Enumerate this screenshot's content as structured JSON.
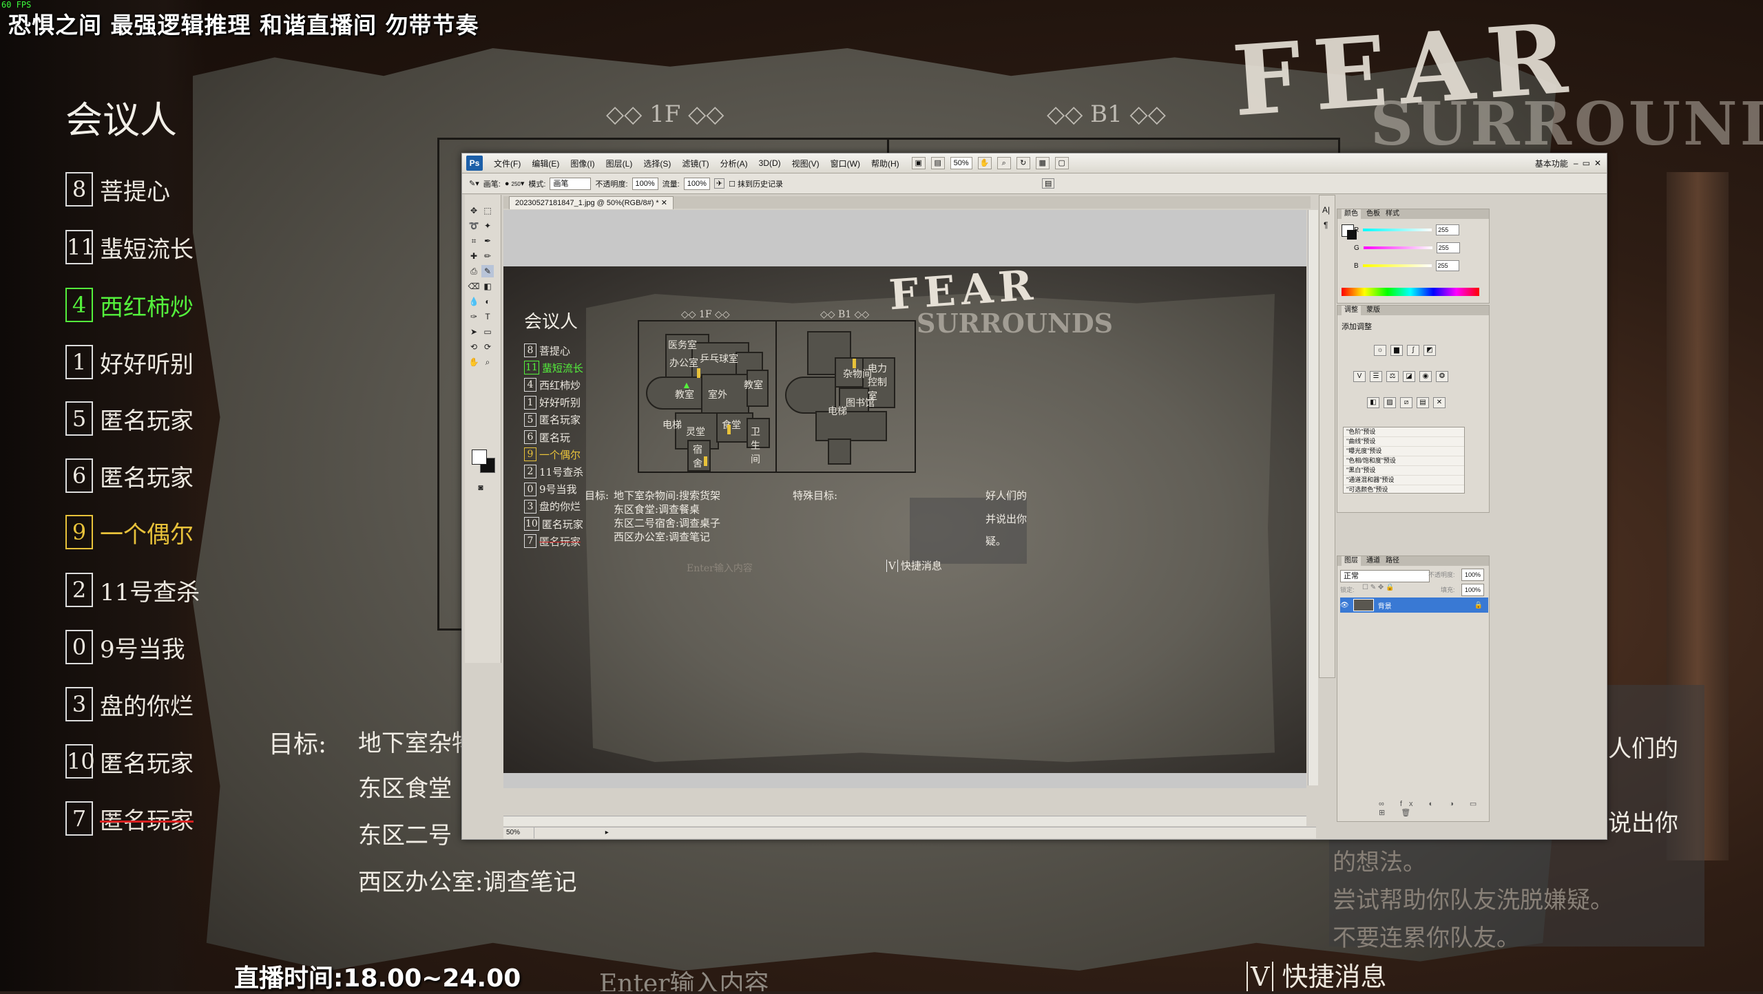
{
  "overlay": {
    "fps": "60 FPS",
    "stream_title": "恐惧之间 最强逻辑推理 和谐直播间 勿带节奏",
    "stream_time": "直播时间:18.00~24.00"
  },
  "game": {
    "logo": "FEAR",
    "logo_sub": "SURROUNDS",
    "members_title": "会议人",
    "members": [
      {
        "num": "8",
        "name": "菩提心",
        "state": "normal"
      },
      {
        "num": "11",
        "name": "蜚短流长",
        "state": "normal"
      },
      {
        "num": "4",
        "name": "西红柿炒",
        "state": "green"
      },
      {
        "num": "1",
        "name": "好好听别",
        "state": "normal"
      },
      {
        "num": "5",
        "name": "匿名玩家",
        "state": "normal"
      },
      {
        "num": "6",
        "name": "匿名玩家",
        "state": "normal"
      },
      {
        "num": "9",
        "name": "一个偶尔",
        "state": "yellow"
      },
      {
        "num": "2",
        "name": "11号查杀",
        "state": "normal"
      },
      {
        "num": "0",
        "name": "9号当我",
        "state": "normal"
      },
      {
        "num": "3",
        "name": "盘的你烂",
        "state": "normal"
      },
      {
        "num": "10",
        "name": "匿名玩家",
        "state": "normal"
      },
      {
        "num": "7",
        "name": "匿名玩家",
        "state": "red"
      }
    ],
    "floor_1f": "1F",
    "floor_b1": "B1",
    "goal_label": "目标:",
    "goal_lines": [
      "地下室杂物",
      "东区食堂",
      "东区二号",
      "西区办公室:调查笔记"
    ],
    "right_lines": [
      "人们的",
      "说出你",
      "的想法。",
      "尝试帮助你队友洗脱嫌疑。",
      "不要连累你队友。"
    ],
    "enter_hint": "Enter输入内容",
    "quick_key": "V",
    "quick_msg": "快捷消息"
  },
  "photoshop": {
    "ps_icon": "Ps",
    "menus": [
      "文件(F)",
      "编辑(E)",
      "图像(I)",
      "图层(L)",
      "选择(S)",
      "滤镜(T)",
      "分析(A)",
      "3D(D)",
      "视图(V)",
      "窗口(W)",
      "帮助(H)"
    ],
    "zoom_select": "50%",
    "workspace": "基本功能",
    "options": {
      "brush_label": "画笔:",
      "brush_size": "250",
      "mode_label": "模式:",
      "mode_value": "画笔",
      "opacity_label": "不透明度:",
      "opacity_value": "100%",
      "flow_label": "流量:",
      "flow_value": "100%",
      "erase_history": "抹到历史记录"
    },
    "doc_tab": "20230527181847_1.jpg @ 50%(RGB/8#) *",
    "status_zoom": "50%",
    "color_panel": {
      "tabs": [
        "颜色",
        "色板",
        "样式"
      ],
      "r_label": "R",
      "r_value": "255",
      "g_label": "G",
      "g_value": "255",
      "b_label": "B",
      "b_value": "255"
    },
    "adjust_panel": {
      "tabs": [
        "调整",
        "蒙版"
      ],
      "title": "添加调整",
      "presets": [
        "\"色阶\"预设",
        "\"曲线\"预设",
        "\"曝光度\"预设",
        "\"色相/饱和度\"预设",
        "\"黑白\"预设",
        "\"通道混和器\"预设",
        "\"可选颜色\"预设"
      ]
    },
    "layers_panel": {
      "tabs": [
        "图层",
        "通道",
        "路径"
      ],
      "blend_mode": "正常",
      "opacity_label": "不透明度:",
      "opacity_value": "100%",
      "lock_label": "锁定:",
      "fill_label": "填充:",
      "fill_value": "100%",
      "layer_name": "背景"
    },
    "doc": {
      "logo": "FEAR",
      "logo_sub": "SURROUNDS",
      "members_title": "会议人",
      "members": [
        {
          "num": "8",
          "name": "菩提心",
          "state": "normal"
        },
        {
          "num": "11",
          "name": "蜚短流长",
          "state": "green"
        },
        {
          "num": "4",
          "name": "西红柿炒",
          "state": "normal"
        },
        {
          "num": "1",
          "name": "好好听别",
          "state": "normal"
        },
        {
          "num": "5",
          "name": "匿名玩家",
          "state": "normal"
        },
        {
          "num": "6",
          "name": "匿名玩",
          "state": "normal"
        },
        {
          "num": "9",
          "name": "一个偶尔",
          "state": "yellow"
        },
        {
          "num": "2",
          "name": "11号查杀",
          "state": "normal"
        },
        {
          "num": "0",
          "name": "9号当我",
          "state": "normal"
        },
        {
          "num": "3",
          "name": "盘的你烂",
          "state": "normal"
        },
        {
          "num": "10",
          "name": "匿名玩家",
          "state": "normal"
        },
        {
          "num": "7",
          "name": "匿名玩家",
          "state": "red"
        }
      ],
      "floor_1f": "1F",
      "floor_b1": "B1",
      "rooms_1f": [
        "医务室",
        "乒乓球室",
        "办公室",
        "教室",
        "室外",
        "教室",
        "电梯",
        "灵堂",
        "食堂",
        "卫生间",
        "宿舍"
      ],
      "rooms_b1": [
        "杂物间",
        "电力控制室",
        "图书馆",
        "电梯"
      ],
      "goal_label": "目标:",
      "goal_lines": [
        "地下室杂物间:搜索货架",
        "东区食堂:调查餐桌",
        "东区二号宿舍:调查桌子",
        "西区办公室:调查笔记"
      ],
      "special_label": "特殊目标:",
      "right_lines": [
        "好人们的",
        "并说出你",
        "疑。"
      ],
      "enter_hint": "Enter输入内容",
      "quick_key": "V",
      "quick_msg": "快捷消息"
    }
  }
}
